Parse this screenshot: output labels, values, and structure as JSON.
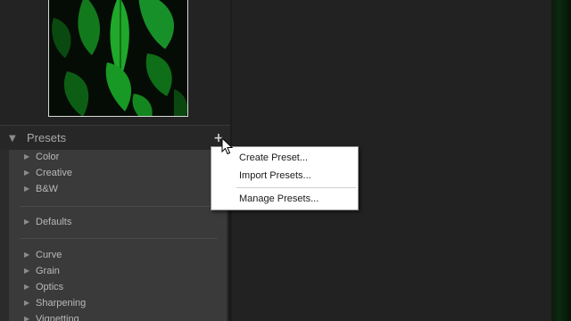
{
  "presets_panel": {
    "title": "Presets",
    "add_button_glyph": "+",
    "items": [
      {
        "label": "Color"
      },
      {
        "label": "Creative"
      },
      {
        "label": "B&W"
      },
      {
        "label": "Defaults"
      },
      {
        "label": "Curve"
      },
      {
        "label": "Grain"
      },
      {
        "label": "Optics"
      },
      {
        "label": "Sharpening"
      },
      {
        "label": "Vignetting"
      }
    ]
  },
  "context_menu": {
    "items": [
      {
        "label": "Create Preset..."
      },
      {
        "label": "Import Presets..."
      },
      {
        "label": "Manage Presets..."
      }
    ]
  },
  "icons": {
    "collapse": "triangle-down-icon",
    "expand": "triangle-right-icon",
    "add": "plus-icon",
    "cursor": "mouse-pointer-icon"
  },
  "colors": {
    "panel_bg": "#2b2b2b",
    "list_bg": "#3a3a3a",
    "menu_bg": "#ffffff",
    "leaf_green": "#1fae2a"
  }
}
